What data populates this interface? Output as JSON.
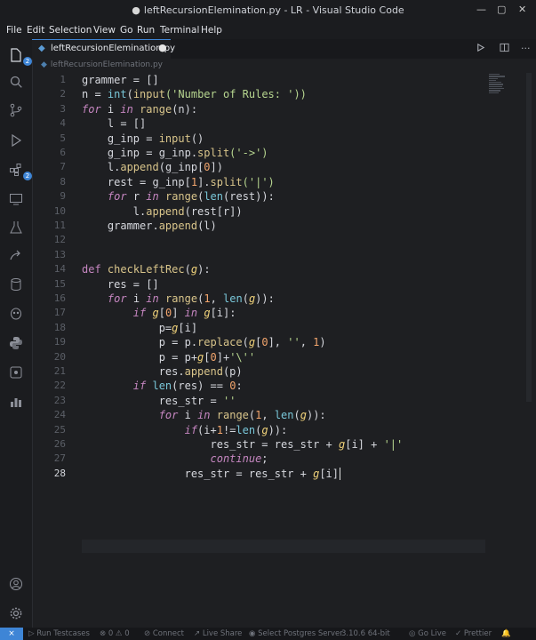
{
  "window": {
    "title": "leftRecursionElemination.py - LR - Visual Studio Code",
    "modified_dot": "●",
    "minimize": "—",
    "maximize": "▢",
    "close": "✕"
  },
  "menu": [
    "File",
    "Edit",
    "Selection",
    "View",
    "Go",
    "Run",
    "Terminal",
    "Help"
  ],
  "activity_badge": "2",
  "tab": {
    "file_name": "leftRecursionElemination.py",
    "modified_marker": "●"
  },
  "breadcrumb": "leftRecursionElemination.py",
  "editor": {
    "current_line": 28,
    "lines": [
      "1",
      "2",
      "3",
      "4",
      "5",
      "6",
      "7",
      "8",
      "9",
      "10",
      "11",
      "12",
      "13",
      "14",
      "15",
      "16",
      "17",
      "18",
      "19",
      "20",
      "21",
      "22",
      "23",
      "24",
      "25",
      "26",
      "27",
      "28"
    ],
    "code": {
      "l1": "grammer = []",
      "l2a": "n = ",
      "l2b": "int",
      "l2c": "(",
      "l2d": "input",
      "l2e": "('",
      "l2f": "Number of Rules: ",
      "l2g": "'))",
      "l3a": "for",
      "l3b": " i ",
      "l3c": "in",
      "l3d": " ",
      "l3e": "range",
      "l3f": "(n):",
      "l4": "    l = []",
      "l5a": "    g_inp = ",
      "l5b": "input",
      "l5c": "()",
      "l6a": "    g_inp = g_inp.",
      "l6b": "split",
      "l6c": "('",
      "l6d": "->",
      "l6e": "')",
      "l7a": "    l.",
      "l7b": "append",
      "l7c": "(g_inp[",
      "l7d": "0",
      "l7e": "])",
      "l8a": "    rest = g_inp[",
      "l8b": "1",
      "l8c": "].",
      "l8d": "split",
      "l8e": "('",
      "l8f": "|",
      "l8g": "')",
      "l9a": "    ",
      "l9b": "for",
      "l9c": " r ",
      "l9d": "in",
      "l9e": " ",
      "l9f": "range",
      "l9g": "(",
      "l9h": "len",
      "l9i": "(rest)):",
      "l10a": "        l.",
      "l10b": "append",
      "l10c": "(rest[r])",
      "l11a": "    grammer.",
      "l11b": "append",
      "l11c": "(l)",
      "l14a": "def",
      "l14b": " ",
      "l14c": "checkLeftRec",
      "l14d": "(",
      "l14e": "g",
      "l14f": "):",
      "l15": "    res = []",
      "l16a": "    ",
      "l16b": "for",
      "l16c": " i ",
      "l16d": "in",
      "l16e": " ",
      "l16f": "range",
      "l16g": "(",
      "l16h": "1",
      "l16i": ", ",
      "l16j": "len",
      "l16k": "(",
      "l16l": "g",
      "l16m": ")):",
      "l17a": "        ",
      "l17b": "if",
      "l17c": " ",
      "l17d": "g",
      "l17e": "[",
      "l17f": "0",
      "l17g": "] ",
      "l17h": "in",
      "l17i": " ",
      "l17j": "g",
      "l17k": "[i]:",
      "l18a": "            p=",
      "l18b": "g",
      "l18c": "[i]",
      "l19a": "            p = p.",
      "l19b": "replace",
      "l19c": "(",
      "l19d": "g",
      "l19e": "[",
      "l19f": "0",
      "l19g": "], ",
      "l19h": "''",
      "l19i": ", ",
      "l19j": "1",
      "l19k": ")",
      "l20a": "            p = p+",
      "l20b": "g",
      "l20c": "[",
      "l20d": "0",
      "l20e": "]+",
      "l20f": "'\\''",
      "l21a": "            res.",
      "l21b": "append",
      "l21c": "(p)",
      "l22a": "        ",
      "l22b": "if",
      "l22c": " ",
      "l22d": "len",
      "l22e": "(res) == ",
      "l22f": "0",
      "l22g": ":",
      "l23a": "            res_str = ",
      "l23b": "''",
      "l24a": "            ",
      "l24b": "for",
      "l24c": " i ",
      "l24d": "in",
      "l24e": " ",
      "l24f": "range",
      "l24g": "(",
      "l24h": "1",
      "l24i": ", ",
      "l24j": "len",
      "l24k": "(",
      "l24l": "g",
      "l24m": ")):",
      "l25a": "                ",
      "l25b": "if",
      "l25c": "(i+",
      "l25d": "1",
      "l25e": "!=",
      "l25f": "len",
      "l25g": "(",
      "l25h": "g",
      "l25i": ")):",
      "l26a": "                    res_str = res_str + ",
      "l26b": "g",
      "l26c": "[i] + ",
      "l26d": "'|'",
      "l27a": "                    ",
      "l27b": "continue",
      "l27c": ";",
      "l28a": "                res_str = res_str + ",
      "l28b": "g",
      "l28c": "[i]"
    }
  },
  "status": {
    "remote_icon": "⨯",
    "run_testcases": "Run Testcases",
    "problems": "⊗ 0 ⚠ 0",
    "connect": "Connect",
    "live_share": "Live Share",
    "postgres": "Select Postgres Server",
    "python": "3.10.6 64-bit",
    "go_live": "Go Live",
    "prettier": "Prettier"
  },
  "colors": {
    "accent": "#3e85d6",
    "background": "#1e1f22",
    "keyword": "#c586c0",
    "function": "#d9c58b",
    "string": "#b6d58f",
    "number": "#f2a56d"
  }
}
